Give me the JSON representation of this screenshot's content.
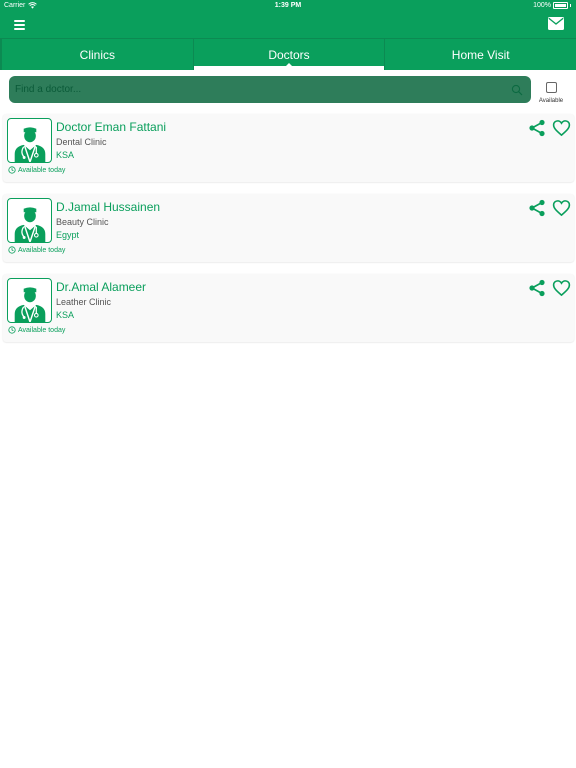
{
  "status_bar": {
    "carrier": "Carrier",
    "time": "1:39 PM",
    "battery": "100%"
  },
  "colors": {
    "primary": "#0a9f5c",
    "search_bg": "#2e7d5a",
    "card_bg": "#f9f9f9"
  },
  "nav": {
    "menu_icon": "hamburger-menu-icon",
    "mail_icon": "envelope-icon"
  },
  "tabs": [
    {
      "label": "Clinics",
      "active": false
    },
    {
      "label": "Doctors",
      "active": true
    },
    {
      "label": "Home Visit",
      "active": false
    }
  ],
  "search": {
    "placeholder": "Find a doctor...",
    "value": "",
    "icon": "search-icon"
  },
  "filter": {
    "available_label": "Available",
    "checked": false
  },
  "doctors": [
    {
      "name": "Doctor Eman Fattani",
      "clinic": "Dental Clinic",
      "country": "KSA",
      "availability": "Available today"
    },
    {
      "name": "D.Jamal Hussainen",
      "clinic": "Beauty Clinic",
      "country": "Egypt",
      "availability": "Available today"
    },
    {
      "name": "Dr.Amal Alameer",
      "clinic": "Leather Clinic",
      "country": "KSA",
      "availability": "Available today"
    }
  ]
}
